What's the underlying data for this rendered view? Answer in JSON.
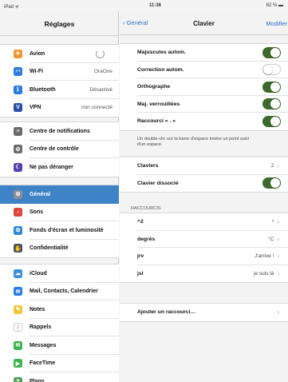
{
  "status_bar": {
    "left": "iPad ᯤ",
    "time": "11:36",
    "right": "82 % ▬"
  },
  "sidebar": {
    "title": "Réglages",
    "groups": [
      [
        {
          "label": "Avion",
          "icon": "airplane-icon",
          "icon_color": "#f0962e",
          "glyph": "✈",
          "control": "toggle-off"
        },
        {
          "label": "Wi-Fi",
          "icon": "wifi-icon",
          "icon_color": "#2a7be0",
          "glyph": "◠",
          "value": "OraOne"
        },
        {
          "label": "Bluetooth",
          "icon": "bluetooth-icon",
          "icon_color": "#2a7be0",
          "glyph": "ᛒ",
          "value": "Désactivé"
        },
        {
          "label": "VPN",
          "icon": "vpn-icon",
          "icon_color": "#2b4ea8",
          "glyph": "V",
          "value": "non connecté"
        }
      ],
      [
        {
          "label": "Centre de notifications",
          "icon": "notifications-icon",
          "icon_color": "#6b6b6b",
          "glyph": "≡"
        },
        {
          "label": "Centre de contrôle",
          "icon": "control-center-icon",
          "icon_color": "#6b6b6b",
          "glyph": "⚙"
        },
        {
          "label": "Ne pas déranger",
          "icon": "do-not-disturb-icon",
          "icon_color": "#5b3fb5",
          "glyph": "☾"
        }
      ],
      [
        {
          "label": "Général",
          "icon": "gear-icon",
          "icon_color": "#8e8e93",
          "glyph": "⚙",
          "selected": true
        },
        {
          "label": "Sons",
          "icon": "sounds-icon",
          "icon_color": "#e0453a",
          "glyph": "♪"
        },
        {
          "label": "Fonds d'écran et luminosité",
          "icon": "wallpaper-icon",
          "icon_color": "#2a8bd6",
          "glyph": "✿"
        },
        {
          "label": "Confidentialité",
          "icon": "privacy-icon",
          "icon_color": "#4b5560",
          "glyph": "✋"
        }
      ],
      [
        {
          "label": "iCloud",
          "icon": "icloud-icon",
          "icon_color": "#3a8fe0",
          "glyph": "☁"
        },
        {
          "label": "Mail, Contacts, Calendrier",
          "icon": "mail-icon",
          "icon_color": "#2a7be0",
          "glyph": "✉"
        },
        {
          "label": "Notes",
          "icon": "notes-icon",
          "icon_color": "#f2c737",
          "glyph": "✎"
        },
        {
          "label": "Rappels",
          "icon": "reminders-icon",
          "icon_color": "#ffffff",
          "glyph": "⋮"
        },
        {
          "label": "Messages",
          "icon": "messages-icon",
          "icon_color": "#3cb44b",
          "glyph": "✉"
        },
        {
          "label": "FaceTime",
          "icon": "facetime-icon",
          "icon_color": "#3cb44b",
          "glyph": "▶"
        },
        {
          "label": "Plans",
          "icon": "maps-icon",
          "icon_color": "#4fa05a",
          "glyph": "⌖"
        }
      ]
    ]
  },
  "main": {
    "back_label": "Général",
    "title": "Clavier",
    "edit_label": "Modifier",
    "toggles": [
      {
        "label": "Majuscules autom.",
        "on": true
      },
      {
        "label": "Correction autom.",
        "on": false
      },
      {
        "label": "Orthographe",
        "on": true
      },
      {
        "label": "Maj. verrouillées",
        "on": true
      },
      {
        "label": "Raccourci « . »",
        "on": true
      }
    ],
    "note": "Un double-clic sur la barre d'espace insère un point suivi d'un espace.",
    "keyboards": [
      {
        "label": "Claviers",
        "value": "2",
        "chevron": true
      },
      {
        "label": "Clavier dissocié",
        "toggle": true,
        "on": true
      }
    ],
    "shortcuts_header": "RACCOURCIS",
    "shortcuts": [
      {
        "label": "^2",
        "value": "²"
      },
      {
        "label": "degrés",
        "value": "°C"
      },
      {
        "label": "jrv",
        "value": "J'arrive !"
      },
      {
        "label": "jsl",
        "value": "je suis là"
      }
    ],
    "add_shortcut": "Ajouter un raccourci…"
  }
}
